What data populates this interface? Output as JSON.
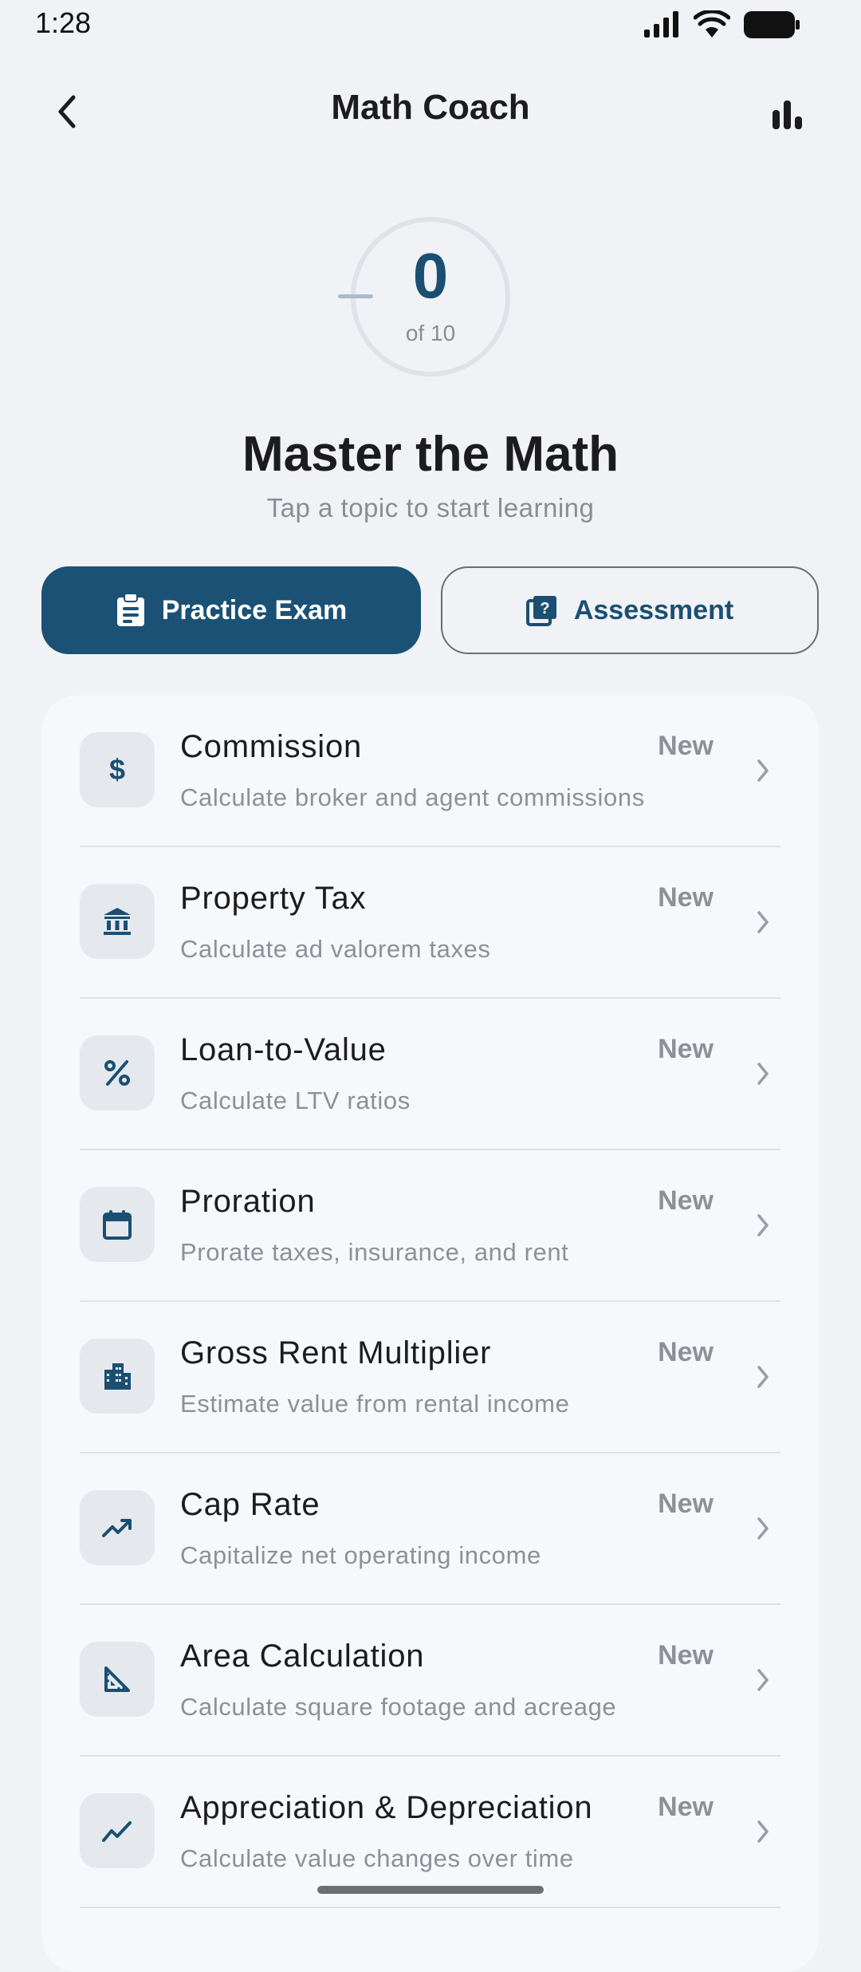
{
  "status": {
    "time": "1:28"
  },
  "nav": {
    "title": "Math Coach"
  },
  "progress": {
    "completed": "0",
    "total_label": "of 10",
    "completed_fraction": 0
  },
  "hero": {
    "title": "Master the Math",
    "subtitle": "Tap a topic to start learning"
  },
  "actions": {
    "practice_label": "Practice Exam",
    "assessment_label": "Assessment"
  },
  "colors": {
    "accent": "#1b5175",
    "background": "#f1f2f5",
    "card": "#f7f8fb",
    "muted": "#8d9095"
  },
  "topics": [
    {
      "title": "Commission",
      "description": "Calculate broker and agent commissions",
      "badge": "New",
      "icon": "dollar-icon"
    },
    {
      "title": "Property Tax",
      "description": "Calculate ad valorem taxes",
      "badge": "New",
      "icon": "bank-icon"
    },
    {
      "title": "Loan-to-Value",
      "description": "Calculate LTV ratios",
      "badge": "New",
      "icon": "percent-icon"
    },
    {
      "title": "Proration",
      "description": "Prorate taxes, insurance, and rent",
      "badge": "New",
      "icon": "calendar-icon"
    },
    {
      "title": "Gross Rent Multiplier",
      "description": "Estimate value from rental income",
      "badge": "New",
      "icon": "apartment-icon"
    },
    {
      "title": "Cap Rate",
      "description": "Capitalize net operating income",
      "badge": "New",
      "icon": "trending-up-icon"
    },
    {
      "title": "Area Calculation",
      "description": "Calculate square footage and acreage",
      "badge": "New",
      "icon": "square-foot-icon"
    },
    {
      "title": "Appreciation & Depreciation",
      "description": "Calculate value changes over time",
      "badge": "New",
      "icon": "trend-line-icon"
    }
  ]
}
